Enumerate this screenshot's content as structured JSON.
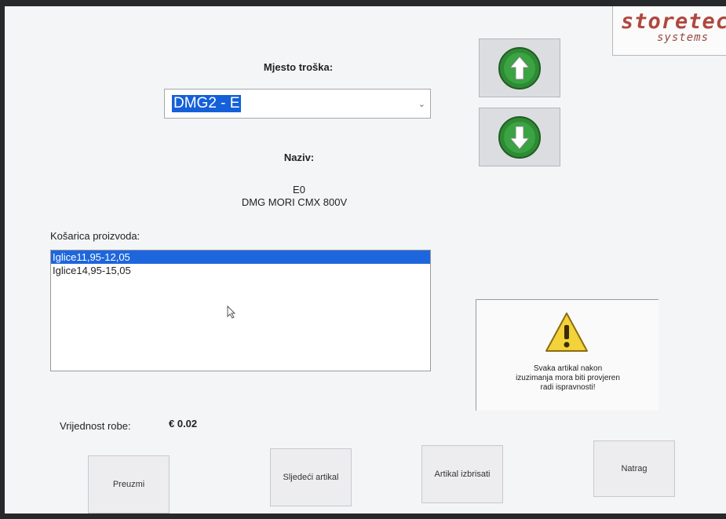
{
  "logo": {
    "line1": "storetec",
    "line2": "systems"
  },
  "cost_center": {
    "label": "Mjesto troška:",
    "selected_value": "DMG2 - E"
  },
  "name": {
    "label": "Naziv:",
    "code": "E0",
    "machine": "DMG MORI CMX 800V"
  },
  "cart": {
    "label": "Košarica proizvoda:",
    "items": [
      {
        "label": "Iglice11,95-12,05",
        "selected": true
      },
      {
        "label": "Iglice14,95-15,05",
        "selected": false
      }
    ]
  },
  "warning": {
    "line1": "Svaka artikal nakon",
    "line2": "izuzimanja mora biti provjeren",
    "line3": "radi ispravnosti!"
  },
  "value": {
    "label": "Vrijednost robe:",
    "amount": "€ 0.02"
  },
  "buttons": {
    "take": "Preuzmi",
    "next": "Sljedeći artikal",
    "delete": "Artikal izbrisati",
    "back": "Natrag"
  },
  "colors": {
    "selection": "#1e66dd",
    "arrow_green": "#2f8a34",
    "logo_red": "#b0473e",
    "warning_yellow": "#f3d23a"
  },
  "icons": {
    "up": "arrow-up-icon",
    "down": "arrow-down-icon",
    "warning": "warning-icon",
    "cursor": "mouse-cursor-icon"
  }
}
